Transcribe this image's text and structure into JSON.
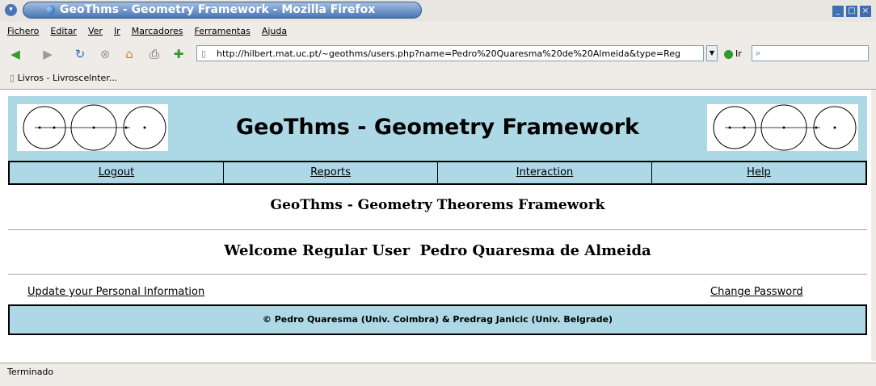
{
  "window": {
    "title": "GeoThms - Geometry Framework - Mozilla Firefox"
  },
  "menubar": {
    "items": [
      "Fichero",
      "Editar",
      "Ver",
      "Ir",
      "Marcadores",
      "Ferramentas",
      "Ajuda"
    ]
  },
  "toolbar": {
    "url": "http://hilbert.mat.uc.pt/~geothms/users.php?name=Pedro%20Quaresma%20de%20Almeida&type=Reg",
    "go_label": "Ir",
    "icons": [
      "back-icon",
      "forward-icon",
      "reload-icon",
      "stop-icon",
      "home-icon",
      "print-icon",
      "new-tab-icon"
    ]
  },
  "bookmarks": {
    "item": "Livros - Livroscelnter..."
  },
  "page": {
    "header_title": "GeoThms - Geometry Framework",
    "nav": [
      "Logout",
      "Reports",
      "Interaction",
      "Help"
    ],
    "subtitle": "GeoThms - Geometry Theorems Framework",
    "welcome": "Welcome Regular User  Pedro Quaresma de Almeida",
    "update_link": "Update your Personal Information",
    "password_link": "Change Password",
    "footer": "© Pedro Quaresma (Univ. Coimbra) & Predrag Janicic (Univ. Belgrade)"
  },
  "status": {
    "text": "Terminado"
  },
  "colors": {
    "header_bg": "#add8e6",
    "chrome_bg": "#efebe7",
    "title_blue": "#4875b6"
  }
}
